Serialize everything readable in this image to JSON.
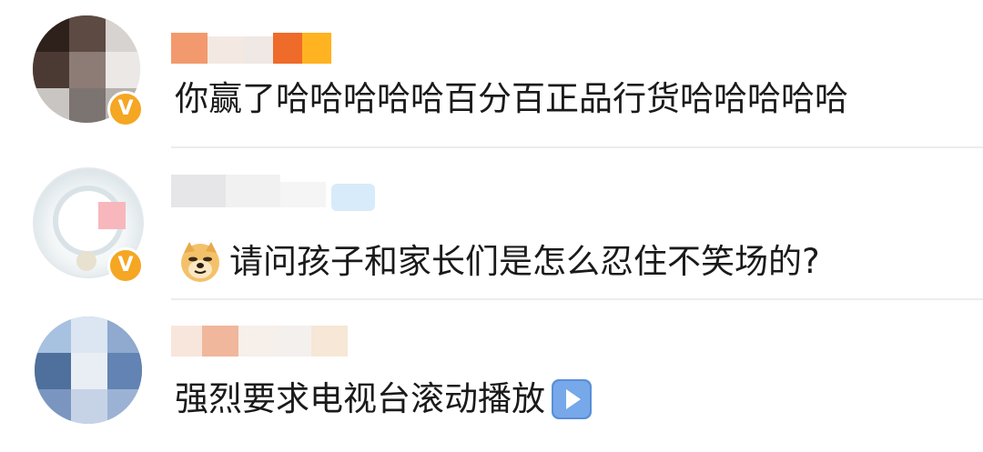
{
  "comments": [
    {
      "text": "你赢了哈哈哈哈哈百分百正品行货哈哈哈哈哈",
      "verified": true,
      "avatar_icon": "blurred-avatar-icon"
    },
    {
      "text": "请问孩子和家长们是怎么忍住不笑场的?",
      "verified": true,
      "leading_emoji": "doge-emoji-icon",
      "avatar_icon": "blurred-avatar-icon"
    },
    {
      "text": "强烈要求电视台滚动播放",
      "verified": false,
      "trailing_emoji": "play-button-emoji-icon",
      "avatar_icon": "blurred-avatar-icon"
    }
  ],
  "badge": {
    "symbol": "V",
    "color": "#f5a623"
  }
}
